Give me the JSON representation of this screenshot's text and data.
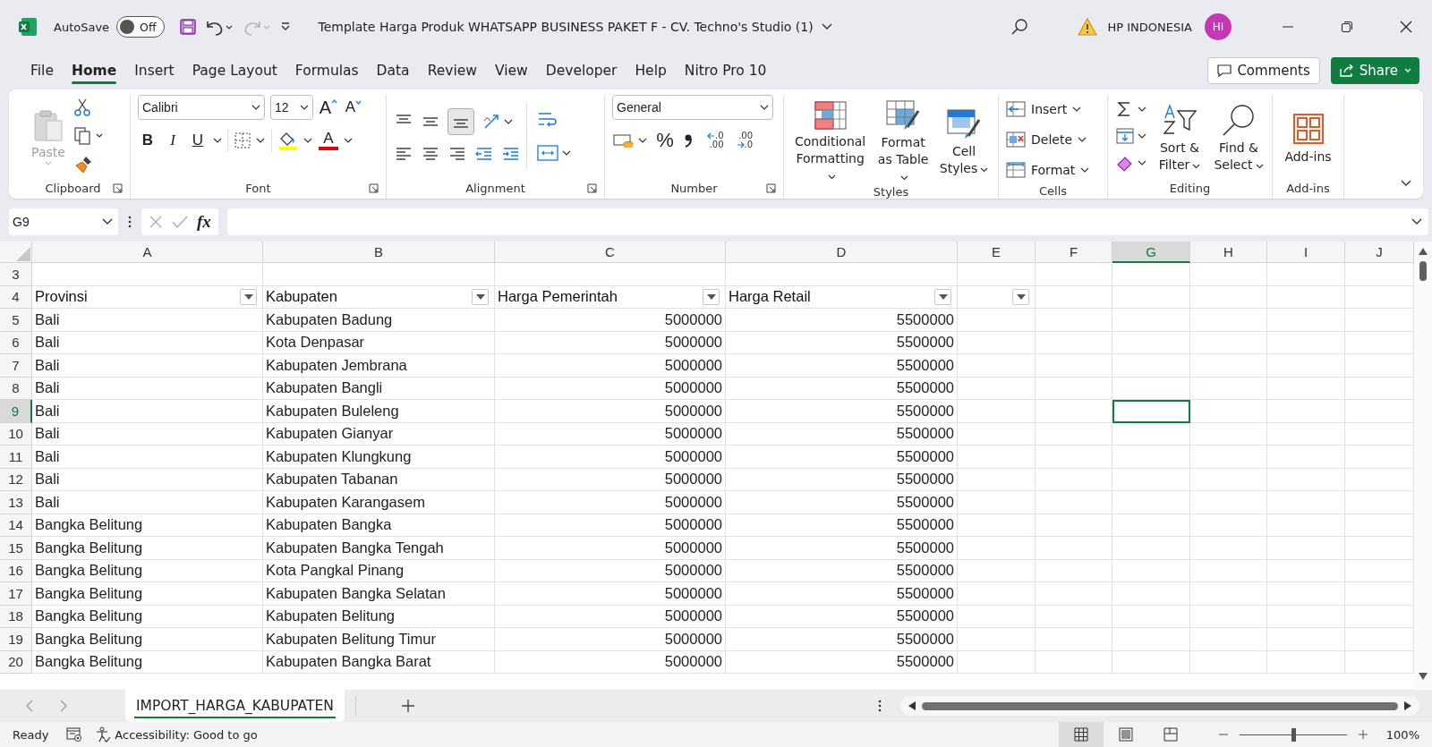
{
  "title_bar": {
    "autosave": {
      "label": "AutoSave",
      "state_label": "Off",
      "on": false
    },
    "redo_enabled": false,
    "document_title": "Template Harga Produk WHATSAPP BUSINESS PAKET F - CV. Techno's Studio (1)",
    "user_name": "HP INDONESIA",
    "avatar_initials": "HI"
  },
  "menu_tabs": [
    {
      "label": "File",
      "selected": false
    },
    {
      "label": "Home",
      "selected": true
    },
    {
      "label": "Insert",
      "selected": false
    },
    {
      "label": "Page Layout",
      "selected": false
    },
    {
      "label": "Formulas",
      "selected": false
    },
    {
      "label": "Data",
      "selected": false
    },
    {
      "label": "Review",
      "selected": false
    },
    {
      "label": "View",
      "selected": false
    },
    {
      "label": "Developer",
      "selected": false
    },
    {
      "label": "Help",
      "selected": false
    },
    {
      "label": "Nitro Pro 10",
      "selected": false
    }
  ],
  "comments_button": "Comments",
  "share_button": "Share",
  "ribbon": {
    "clipboard": {
      "label": "Clipboard",
      "paste": "Paste",
      "paste_enabled": false
    },
    "font": {
      "label": "Font",
      "font_name": "Calibri",
      "font_size": "12",
      "grow": "A",
      "shrink": "A",
      "bold": "B",
      "italic": "I",
      "underline": "U",
      "font_color": "A"
    },
    "alignment": {
      "label": "Alignment",
      "bottom_align_selected": true
    },
    "number": {
      "label": "Number",
      "format": "General",
      "percent": "%",
      "decimals": [
        {
          "top": ".0",
          "bottom": ".00"
        },
        {
          "top": ".00",
          "bottom": ".0"
        }
      ]
    },
    "styles": {
      "label": "Styles",
      "buttons": [
        "Conditional Formatting",
        "Format as Table",
        "Cell Styles"
      ]
    },
    "cells": {
      "label": "Cells",
      "buttons": [
        "Insert",
        "Delete",
        "Format"
      ]
    },
    "editing": {
      "label": "Editing",
      "buttons": [
        "Sort & Filter",
        "Find & Select"
      ]
    },
    "add_ins": {
      "label": "Add-ins",
      "button": "Add-ins"
    }
  },
  "formula_bar": {
    "name_box": "G9",
    "function_label": "fx"
  },
  "columns": [
    {
      "label": "A",
      "selected": false
    },
    {
      "label": "B",
      "selected": false
    },
    {
      "label": "C",
      "selected": false
    },
    {
      "label": "D",
      "selected": false
    },
    {
      "label": "E",
      "selected": false
    },
    {
      "label": "F",
      "selected": false
    },
    {
      "label": "G",
      "selected": true
    },
    {
      "label": "H",
      "selected": false
    },
    {
      "label": "I",
      "selected": false
    },
    {
      "label": "J",
      "selected": false
    }
  ],
  "rows": [
    {
      "number": "3",
      "kind": "blank",
      "selected": false
    },
    {
      "number": "4",
      "kind": "header",
      "selected": false,
      "cells": [
        "Provinsi",
        "Kabupaten",
        "Harga Pemerintah",
        "Harga Retail"
      ]
    },
    {
      "number": "5",
      "kind": "data",
      "selected": false,
      "cells": [
        "Bali",
        "Kabupaten Badung",
        "5000000",
        "5500000"
      ]
    },
    {
      "number": "6",
      "kind": "data",
      "selected": false,
      "cells": [
        "Bali",
        "Kota Denpasar",
        "5000000",
        "5500000"
      ]
    },
    {
      "number": "7",
      "kind": "data",
      "selected": false,
      "cells": [
        "Bali",
        "Kabupaten Jembrana",
        "5000000",
        "5500000"
      ]
    },
    {
      "number": "8",
      "kind": "data",
      "selected": false,
      "cells": [
        "Bali",
        "Kabupaten Bangli",
        "5000000",
        "5500000"
      ]
    },
    {
      "number": "9",
      "kind": "data",
      "selected": true,
      "cells": [
        "Bali",
        "Kabupaten Buleleng",
        "5000000",
        "5500000"
      ]
    },
    {
      "number": "10",
      "kind": "data",
      "selected": false,
      "cells": [
        "Bali",
        "Kabupaten Gianyar",
        "5000000",
        "5500000"
      ]
    },
    {
      "number": "11",
      "kind": "data",
      "selected": false,
      "cells": [
        "Bali",
        "Kabupaten Klungkung",
        "5000000",
        "5500000"
      ]
    },
    {
      "number": "12",
      "kind": "data",
      "selected": false,
      "cells": [
        "Bali",
        "Kabupaten Tabanan",
        "5000000",
        "5500000"
      ]
    },
    {
      "number": "13",
      "kind": "data",
      "selected": false,
      "cells": [
        "Bali",
        "Kabupaten Karangasem",
        "5000000",
        "5500000"
      ]
    },
    {
      "number": "14",
      "kind": "data",
      "selected": false,
      "cells": [
        "Bangka Belitung",
        "Kabupaten Bangka",
        "5000000",
        "5500000"
      ]
    },
    {
      "number": "15",
      "kind": "data",
      "selected": false,
      "cells": [
        "Bangka Belitung",
        "Kabupaten Bangka Tengah",
        "5000000",
        "5500000"
      ]
    },
    {
      "number": "16",
      "kind": "data",
      "selected": false,
      "cells": [
        "Bangka Belitung",
        "Kota Pangkal Pinang",
        "5000000",
        "5500000"
      ]
    },
    {
      "number": "17",
      "kind": "data",
      "selected": false,
      "cells": [
        "Bangka Belitung",
        "Kabupaten Bangka Selatan",
        "5000000",
        "5500000"
      ]
    },
    {
      "number": "18",
      "kind": "data",
      "selected": false,
      "cells": [
        "Bangka Belitung",
        "Kabupaten Belitung",
        "5000000",
        "5500000"
      ]
    },
    {
      "number": "19",
      "kind": "data",
      "selected": false,
      "cells": [
        "Bangka Belitung",
        "Kabupaten Belitung Timur",
        "5000000",
        "5500000"
      ]
    },
    {
      "number": "20",
      "kind": "data",
      "selected": false,
      "cells": [
        "Bangka Belitung",
        "Kabupaten Bangka Barat",
        "5000000",
        "5500000"
      ]
    }
  ],
  "sheet_tabs": [
    {
      "label": "IMPORT_HARGA_KABUPATEN",
      "selected": true
    }
  ],
  "status_bar": {
    "ready": "Ready",
    "accessibility": "Accessibility: Good to go",
    "views": [
      {
        "selected": true
      },
      {
        "selected": false
      },
      {
        "selected": false
      }
    ],
    "zoom_slider": {
      "level": 0.5
    },
    "zoom": "100%"
  }
}
